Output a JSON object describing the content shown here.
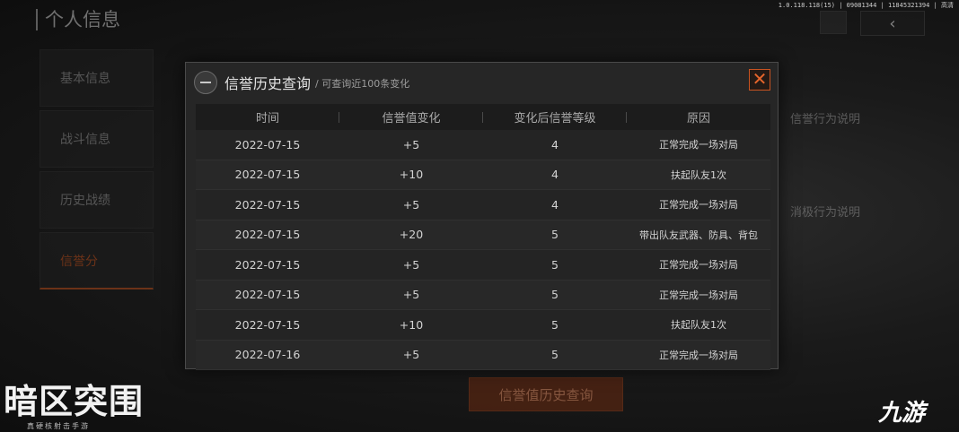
{
  "background": {
    "page_title": "个人信息",
    "version": "1.0.118.118(15) | 09081344 | 11845321394 | 高清",
    "nav": [
      {
        "label": "基本信息"
      },
      {
        "label": "战斗信息"
      },
      {
        "label": "历史战绩"
      },
      {
        "label": "信誉分"
      }
    ],
    "right_panel": {
      "positive_heading": "信誉行为说明",
      "negative_heading": "消极行为说明"
    },
    "query_button": "信誉值历史查询",
    "logo": "暗区突围",
    "logo_sub": "真硬核射击手游",
    "watermark": "九游"
  },
  "modal": {
    "title": "信誉历史查询",
    "subtitle": "/ 可查询近100条变化",
    "close_symbol": "✕",
    "columns": [
      "时间",
      "信誉值变化",
      "变化后信誉等级",
      "原因"
    ],
    "rows": [
      {
        "date": "2022-07-15",
        "change": "+5",
        "level": "4",
        "reason": "正常完成一场对局"
      },
      {
        "date": "2022-07-15",
        "change": "+10",
        "level": "4",
        "reason": "扶起队友1次"
      },
      {
        "date": "2022-07-15",
        "change": "+5",
        "level": "4",
        "reason": "正常完成一场对局"
      },
      {
        "date": "2022-07-15",
        "change": "+20",
        "level": "5",
        "reason": "带出队友武器、防具、背包"
      },
      {
        "date": "2022-07-15",
        "change": "+5",
        "level": "5",
        "reason": "正常完成一场对局"
      },
      {
        "date": "2022-07-15",
        "change": "+5",
        "level": "5",
        "reason": "正常完成一场对局"
      },
      {
        "date": "2022-07-15",
        "change": "+10",
        "level": "5",
        "reason": "扶起队友1次"
      },
      {
        "date": "2022-07-16",
        "change": "+5",
        "level": "5",
        "reason": "正常完成一场对局"
      }
    ]
  },
  "colors": {
    "accent": "#e5652b",
    "modal_bg": "#262626",
    "header_bg": "#1c1c1c"
  }
}
